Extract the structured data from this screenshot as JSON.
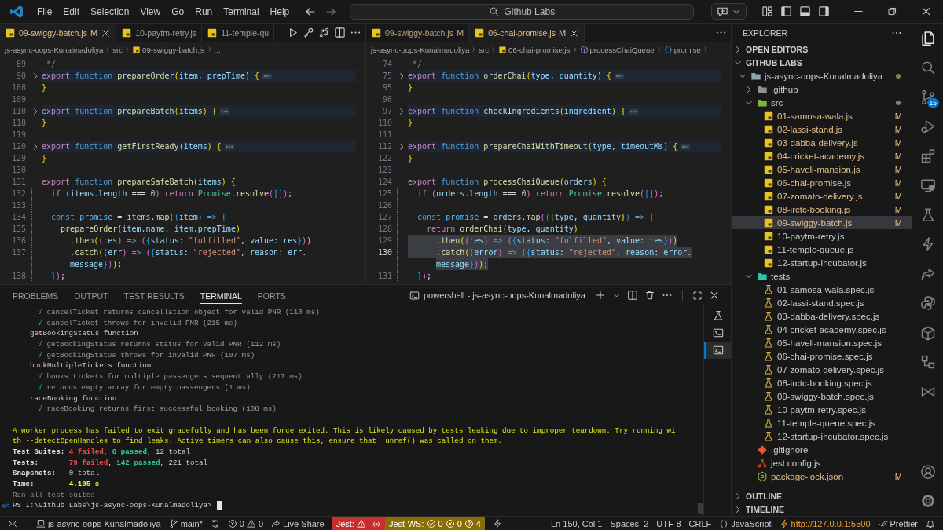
{
  "menu": [
    "File",
    "Edit",
    "Selection",
    "View",
    "Go",
    "Run",
    "Terminal",
    "Help"
  ],
  "title_bar": {
    "search": "Github Labs"
  },
  "editor_groups": [
    {
      "tabs": [
        {
          "label": "09-swiggy-batch.js",
          "badge": "M",
          "selected": true
        },
        {
          "label": "10-paytm-retry.js",
          "selected": false
        },
        {
          "label": "11-temple-qu",
          "selected": false
        }
      ],
      "actions": [
        {
          "kind": "run"
        },
        {
          "kind": "key"
        },
        {
          "kind": "compare"
        },
        {
          "kind": "split"
        },
        {
          "kind": "more"
        }
      ],
      "breadcrumbs": [
        {
          "text": "js-async-oops-Kunalmadoliya",
          "kind": "folder"
        },
        {
          "text": "src",
          "kind": "folder"
        },
        {
          "text": "09-swiggy-batch.js",
          "kind": "file"
        },
        {
          "text": "...",
          "kind": "folder"
        }
      ],
      "lines": [
        {
          "number": "89",
          "tokens": [
            {
              "kind": "comment",
              "text": " */"
            }
          ]
        },
        {
          "number": "90",
          "folded": true,
          "tokens": [
            {
              "kind": "keyword",
              "text": "export "
            },
            {
              "kind": "storage",
              "text": "function "
            },
            {
              "kind": "function",
              "text": "prepareOrder"
            },
            {
              "kind": "bracket1",
              "text": "("
            },
            {
              "kind": "variable",
              "text": "item"
            },
            {
              "kind": "plain",
              "text": ", "
            },
            {
              "kind": "variable",
              "text": "prepTime"
            },
            {
              "kind": "bracket1",
              "text": ") {"
            }
          ]
        },
        {
          "number": "108",
          "tokens": [
            {
              "kind": "bracket1",
              "text": "}"
            }
          ]
        },
        {
          "number": "109"
        },
        {
          "number": "110",
          "folded": true,
          "tokens": [
            {
              "kind": "keyword",
              "text": "export "
            },
            {
              "kind": "storage",
              "text": "function "
            },
            {
              "kind": "function",
              "text": "prepareBatch"
            },
            {
              "kind": "bracket1",
              "text": "("
            },
            {
              "kind": "variable",
              "text": "items"
            },
            {
              "kind": "bracket1",
              "text": ") {"
            }
          ]
        },
        {
          "number": "118",
          "tokens": [
            {
              "kind": "bracket1",
              "text": "}"
            }
          ]
        },
        {
          "number": "119"
        },
        {
          "number": "120",
          "folded": true,
          "tokens": [
            {
              "kind": "keyword",
              "text": "export "
            },
            {
              "kind": "storage",
              "text": "function "
            },
            {
              "kind": "function",
              "text": "getFirstReady"
            },
            {
              "kind": "bracket1",
              "text": "("
            },
            {
              "kind": "variable",
              "text": "items"
            },
            {
              "kind": "bracket1",
              "text": ") {"
            }
          ]
        },
        {
          "number": "129",
          "tokens": [
            {
              "kind": "bracket1",
              "text": "}"
            }
          ]
        },
        {
          "number": "130"
        },
        {
          "number": "131",
          "tokens": [
            {
              "kind": "keyword",
              "text": "export "
            },
            {
              "kind": "storage",
              "text": "function "
            },
            {
              "kind": "function",
              "text": "prepareSafeBatch"
            },
            {
              "kind": "bracket1",
              "text": "("
            },
            {
              "kind": "variable",
              "text": "items"
            },
            {
              "kind": "bracket1",
              "text": ") {"
            }
          ]
        },
        {
          "number": "132",
          "changed": true,
          "tokens": [
            {
              "kind": "keyword",
              "text": "  if "
            },
            {
              "kind": "bracket2",
              "text": "("
            },
            {
              "kind": "variable",
              "text": "items"
            },
            {
              "kind": "plain",
              "text": "."
            },
            {
              "kind": "variable",
              "text": "length"
            },
            {
              "kind": "plain",
              "text": " === "
            },
            {
              "kind": "number",
              "text": "0"
            },
            {
              "kind": "bracket2",
              "text": ") "
            },
            {
              "kind": "keyword",
              "text": "return "
            },
            {
              "kind": "class",
              "text": "Promise"
            },
            {
              "kind": "plain",
              "text": "."
            },
            {
              "kind": "function",
              "text": "resolve"
            },
            {
              "kind": "bracket2",
              "text": "("
            },
            {
              "kind": "bracket3",
              "text": "[]"
            },
            {
              "kind": "bracket2",
              "text": ")"
            },
            {
              "kind": "plain",
              "text": ";"
            }
          ]
        },
        {
          "number": "133",
          "changed": true
        },
        {
          "number": "134",
          "changed": true,
          "tokens": [
            {
              "kind": "storage",
              "text": "  const "
            },
            {
              "kind": "constant",
              "text": "promise"
            },
            {
              "kind": "plain",
              "text": " = "
            },
            {
              "kind": "variable",
              "text": "items"
            },
            {
              "kind": "plain",
              "text": "."
            },
            {
              "kind": "function",
              "text": "map"
            },
            {
              "kind": "bracket2",
              "text": "("
            },
            {
              "kind": "bracket3",
              "text": "("
            },
            {
              "kind": "variable",
              "text": "item"
            },
            {
              "kind": "bracket3",
              "text": ") "
            },
            {
              "kind": "storage",
              "text": "=> "
            },
            {
              "kind": "bracket3",
              "text": "{"
            }
          ]
        },
        {
          "number": "135",
          "changed": true,
          "tokens": [
            {
              "kind": "function",
              "text": "    prepareOrder"
            },
            {
              "kind": "bracket1",
              "text": "("
            },
            {
              "kind": "variable",
              "text": "item"
            },
            {
              "kind": "plain",
              "text": "."
            },
            {
              "kind": "variable",
              "text": "name"
            },
            {
              "kind": "plain",
              "text": ", "
            },
            {
              "kind": "variable",
              "text": "item"
            },
            {
              "kind": "plain",
              "text": "."
            },
            {
              "kind": "variable",
              "text": "prepTime"
            },
            {
              "kind": "bracket1",
              "text": ")"
            }
          ]
        },
        {
          "number": "136",
          "changed": true,
          "tokens": [
            {
              "kind": "plain",
              "text": "      ."
            },
            {
              "kind": "function",
              "text": "then"
            },
            {
              "kind": "bracket1",
              "text": "("
            },
            {
              "kind": "bracket2",
              "text": "("
            },
            {
              "kind": "variable",
              "text": "res"
            },
            {
              "kind": "bracket2",
              "text": ") "
            },
            {
              "kind": "storage",
              "text": "=> "
            },
            {
              "kind": "bracket2",
              "text": "("
            },
            {
              "kind": "bracket3",
              "text": "{"
            },
            {
              "kind": "variable",
              "text": "status"
            },
            {
              "kind": "plain",
              "text": ": "
            },
            {
              "kind": "string",
              "text": "\"fulfilled\""
            },
            {
              "kind": "plain",
              "text": ", "
            },
            {
              "kind": "variable",
              "text": "value"
            },
            {
              "kind": "plain",
              "text": ": "
            },
            {
              "kind": "variable",
              "text": "res"
            },
            {
              "kind": "bracket3",
              "text": "}"
            },
            {
              "kind": "bracket2",
              "text": ")"
            },
            {
              "kind": "bracket1",
              "text": ")"
            }
          ]
        },
        {
          "number": "137",
          "changed": true,
          "tokens": [
            {
              "kind": "plain",
              "text": "      ."
            },
            {
              "kind": "function",
              "text": "catch"
            },
            {
              "kind": "bracket1",
              "text": "("
            },
            {
              "kind": "bracket2",
              "text": "("
            },
            {
              "kind": "variable",
              "text": "err"
            },
            {
              "kind": "bracket2",
              "text": ") "
            },
            {
              "kind": "storage",
              "text": "=> "
            },
            {
              "kind": "bracket2",
              "text": "("
            },
            {
              "kind": "bracket3",
              "text": "{"
            },
            {
              "kind": "variable",
              "text": "status"
            },
            {
              "kind": "plain",
              "text": ": "
            },
            {
              "kind": "string",
              "text": "\"rejected\""
            },
            {
              "kind": "plain",
              "text": ", "
            },
            {
              "kind": "variable",
              "text": "reason"
            },
            {
              "kind": "plain",
              "text": ": "
            },
            {
              "kind": "variable",
              "text": "err"
            },
            {
              "kind": "plain",
              "text": "."
            }
          ],
          "wrap_tokens": [
            {
              "kind": "variable",
              "text": "message"
            },
            {
              "kind": "bracket3",
              "text": "}"
            },
            {
              "kind": "bracket2",
              "text": ")"
            },
            {
              "kind": "bracket1",
              "text": ")"
            },
            {
              "kind": "plain",
              "text": ";"
            }
          ]
        },
        {
          "number": "138",
          "changed": true,
          "tokens": [
            {
              "kind": "bracket3",
              "text": "  }"
            },
            {
              "kind": "bracket2",
              "text": ")"
            },
            {
              "kind": "plain",
              "text": ";"
            }
          ]
        }
      ]
    },
    {
      "tabs": [
        {
          "label": "09-swiggy-batch.js",
          "badge": "M",
          "selected": false
        },
        {
          "label": "06-chai-promise.js",
          "badge": "M",
          "selected": true
        }
      ],
      "actions": [
        {
          "kind": "more"
        }
      ],
      "breadcrumbs": [
        {
          "text": "js-async-oops-Kunalmadoliya",
          "kind": "folder"
        },
        {
          "text": "src",
          "kind": "folder"
        },
        {
          "text": "06-chai-promise.js",
          "kind": "file"
        },
        {
          "text": "processChaiQueue",
          "kind": "function"
        },
        {
          "text": "promise",
          "kind": "variable"
        }
      ],
      "breadcrumb_trailing_separator": true,
      "lines": [
        {
          "number": "74",
          "tokens": [
            {
              "kind": "comment",
              "text": " */"
            }
          ]
        },
        {
          "number": "75",
          "folded": true,
          "tokens": [
            {
              "kind": "keyword",
              "text": "export "
            },
            {
              "kind": "storage",
              "text": "function "
            },
            {
              "kind": "function",
              "text": "orderChai"
            },
            {
              "kind": "bracket1",
              "text": "("
            },
            {
              "kind": "variable",
              "text": "type"
            },
            {
              "kind": "plain",
              "text": ", "
            },
            {
              "kind": "variable",
              "text": "quantity"
            },
            {
              "kind": "bracket1",
              "text": ") {"
            }
          ]
        },
        {
          "number": "95",
          "tokens": [
            {
              "kind": "bracket1",
              "text": "}"
            }
          ]
        },
        {
          "number": "96"
        },
        {
          "number": "97",
          "folded": true,
          "tokens": [
            {
              "kind": "keyword",
              "text": "export "
            },
            {
              "kind": "storage",
              "text": "function "
            },
            {
              "kind": "function",
              "text": "checkIngredients"
            },
            {
              "kind": "bracket1",
              "text": "("
            },
            {
              "kind": "variable",
              "text": "ingredient"
            },
            {
              "kind": "bracket1",
              "text": ") {"
            }
          ]
        },
        {
          "number": "110",
          "tokens": [
            {
              "kind": "bracket1",
              "text": "}"
            }
          ]
        },
        {
          "number": "111"
        },
        {
          "number": "112",
          "folded": true,
          "tokens": [
            {
              "kind": "keyword",
              "text": "export "
            },
            {
              "kind": "storage",
              "text": "function "
            },
            {
              "kind": "function",
              "text": "prepareChaiWithTimeout"
            },
            {
              "kind": "bracket1",
              "text": "("
            },
            {
              "kind": "variable",
              "text": "type"
            },
            {
              "kind": "plain",
              "text": ", "
            },
            {
              "kind": "variable",
              "text": "timeoutMs"
            },
            {
              "kind": "bracket1",
              "text": ") {"
            }
          ]
        },
        {
          "number": "122",
          "tokens": [
            {
              "kind": "bracket1",
              "text": "}"
            }
          ]
        },
        {
          "number": "123"
        },
        {
          "number": "124",
          "tokens": [
            {
              "kind": "keyword",
              "text": "export "
            },
            {
              "kind": "storage",
              "text": "function "
            },
            {
              "kind": "function",
              "text": "processChaiQueue"
            },
            {
              "kind": "bracket1",
              "text": "("
            },
            {
              "kind": "variable",
              "text": "orders"
            },
            {
              "kind": "bracket1",
              "text": ") {"
            }
          ]
        },
        {
          "number": "125",
          "changed": true,
          "tokens": [
            {
              "kind": "keyword",
              "text": "  if "
            },
            {
              "kind": "bracket2",
              "text": "("
            },
            {
              "kind": "variable",
              "text": "orders"
            },
            {
              "kind": "plain",
              "text": "."
            },
            {
              "kind": "variable",
              "text": "length"
            },
            {
              "kind": "plain",
              "text": " === "
            },
            {
              "kind": "number",
              "text": "0"
            },
            {
              "kind": "bracket2",
              "text": ") "
            },
            {
              "kind": "keyword",
              "text": "return "
            },
            {
              "kind": "class",
              "text": "Promise"
            },
            {
              "kind": "plain",
              "text": "."
            },
            {
              "kind": "function",
              "text": "resolve"
            },
            {
              "kind": "bracket2",
              "text": "("
            },
            {
              "kind": "bracket3",
              "text": "[]"
            },
            {
              "kind": "bracket2",
              "text": ")"
            },
            {
              "kind": "plain",
              "text": ";"
            }
          ]
        },
        {
          "number": "126",
          "changed": true
        },
        {
          "number": "127",
          "changed": true,
          "tokens": [
            {
              "kind": "storage",
              "text": "  const "
            },
            {
              "kind": "constant",
              "text": "promise"
            },
            {
              "kind": "plain",
              "text": " = "
            },
            {
              "kind": "variable",
              "text": "orders"
            },
            {
              "kind": "plain",
              "text": "."
            },
            {
              "kind": "function",
              "text": "map"
            },
            {
              "kind": "bracket2",
              "text": "("
            },
            {
              "kind": "bracket3",
              "text": "("
            },
            {
              "kind": "bracket1",
              "text": "{"
            },
            {
              "kind": "variable",
              "text": "type"
            },
            {
              "kind": "plain",
              "text": ", "
            },
            {
              "kind": "variable",
              "text": "quantity"
            },
            {
              "kind": "bracket1",
              "text": "}"
            },
            {
              "kind": "bracket3",
              "text": ") "
            },
            {
              "kind": "storage",
              "text": "=> "
            },
            {
              "kind": "bracket3",
              "text": "{"
            }
          ]
        },
        {
          "number": "128",
          "changed": true,
          "tokens": [
            {
              "kind": "keyword",
              "text": "    return "
            },
            {
              "kind": "function",
              "text": "orderChai"
            },
            {
              "kind": "bracket1",
              "text": "("
            },
            {
              "kind": "variable",
              "text": "type"
            },
            {
              "kind": "plain",
              "text": ", "
            },
            {
              "kind": "variable",
              "text": "quantity"
            },
            {
              "kind": "bracket1",
              "text": ")"
            }
          ]
        },
        {
          "number": "129",
          "changed": true,
          "selected": true,
          "tokens": [
            {
              "kind": "plain",
              "text": "      ."
            },
            {
              "kind": "function",
              "text": "then"
            },
            {
              "kind": "bracket1",
              "text": "("
            },
            {
              "kind": "bracket2",
              "text": "("
            },
            {
              "kind": "variable",
              "text": "res"
            },
            {
              "kind": "bracket2",
              "text": ") "
            },
            {
              "kind": "storage",
              "text": "=> "
            },
            {
              "kind": "bracket2",
              "text": "("
            },
            {
              "kind": "bracket3",
              "text": "{"
            },
            {
              "kind": "variable",
              "text": "status"
            },
            {
              "kind": "plain",
              "text": ": "
            },
            {
              "kind": "string",
              "text": "\"fulfilled\""
            },
            {
              "kind": "plain",
              "text": ", "
            },
            {
              "kind": "variable",
              "text": "value"
            },
            {
              "kind": "plain",
              "text": ": "
            },
            {
              "kind": "variable",
              "text": "res"
            },
            {
              "kind": "bracket3",
              "text": "}"
            },
            {
              "kind": "bracket2",
              "text": ")"
            },
            {
              "kind": "bracket1",
              "text": ")"
            }
          ]
        },
        {
          "number": "130",
          "changed": true,
          "selected": true,
          "current": true,
          "tokens": [
            {
              "kind": "plain",
              "text": "      ."
            },
            {
              "kind": "function",
              "text": "catch"
            },
            {
              "kind": "bracket1",
              "text": "("
            },
            {
              "kind": "bracket2",
              "text": "("
            },
            {
              "kind": "variable",
              "text": "error"
            },
            {
              "kind": "bracket2",
              "text": ") "
            },
            {
              "kind": "storage",
              "text": "=> "
            },
            {
              "kind": "bracket2",
              "text": "("
            },
            {
              "kind": "bracket3",
              "text": "{"
            },
            {
              "kind": "variable",
              "text": "status"
            },
            {
              "kind": "plain",
              "text": ": "
            },
            {
              "kind": "string",
              "text": "\"rejected\""
            },
            {
              "kind": "plain",
              "text": ", "
            },
            {
              "kind": "variable",
              "text": "reason"
            },
            {
              "kind": "plain",
              "text": ": "
            },
            {
              "kind": "variable",
              "text": "error"
            },
            {
              "kind": "plain",
              "text": "."
            }
          ],
          "wrap_tokens": [
            {
              "kind": "variable",
              "text": "message"
            },
            {
              "kind": "bracket3",
              "text": "}"
            },
            {
              "kind": "bracket2",
              "text": ")"
            },
            {
              "kind": "bracket1",
              "text": ")"
            },
            {
              "kind": "plain",
              "text": ";"
            }
          ]
        },
        {
          "number": "131",
          "changed": true,
          "tokens": [
            {
              "kind": "bracket3",
              "text": "  }"
            },
            {
              "kind": "bracket2",
              "text": ")"
            },
            {
              "kind": "plain",
              "text": ";"
            }
          ]
        }
      ]
    }
  ],
  "panel": {
    "tabs": [
      {
        "label": "PROBLEMS",
        "selected": false
      },
      {
        "label": "OUTPUT",
        "selected": false
      },
      {
        "label": "TEST RESULTS",
        "selected": false
      },
      {
        "label": "TERMINAL",
        "selected": true
      },
      {
        "label": "PORTS",
        "selected": false
      }
    ],
    "terminal_title": "powershell - js-async-oops-Kunalmadoliya",
    "terminal_list": [
      {
        "kind": "test",
        "selected": false
      },
      {
        "kind": "shell",
        "selected": false
      },
      {
        "kind": "shell",
        "selected": true
      }
    ],
    "lines": [
      {
        "kind": "pass",
        "mark": "√",
        "text": "cancelTicket returns cancellation object for valid PNR (110 ms)"
      },
      {
        "kind": "pass",
        "mark": "√",
        "text": "cancelTicket throws for invalid PNR (215 ms)"
      },
      {
        "kind": "group",
        "text": "getBookingStatus function"
      },
      {
        "kind": "pass",
        "mark": "√",
        "text": "getBookingStatus returns status for valid PNR (112 ms)"
      },
      {
        "kind": "pass",
        "mark": "√",
        "text": "getBookingStatus throws for invalid PNR (107 ms)"
      },
      {
        "kind": "group",
        "text": "bookMultipleTickets function"
      },
      {
        "kind": "pass",
        "mark": "√",
        "text": "books tickets for multiple passengers sequentially (217 ms)"
      },
      {
        "kind": "pass",
        "mark": "√",
        "text": "returns empty array for empty passengers (1 ms)"
      },
      {
        "kind": "group",
        "text": "raceBooking function"
      },
      {
        "kind": "pass",
        "mark": "√",
        "text": "raceBooking returns first successful booking (108 ms)"
      },
      {
        "kind": "blank"
      },
      {
        "kind": "warning",
        "text": "A worker process has failed to exit gracefully and has been force exited. This is likely caused by tests leaking due to improper teardown. Try running wi"
      },
      {
        "kind": "warning",
        "text": "th --detectOpenHandles to find leaks. Active timers can also cause this, ensure that .unref() was called on them."
      },
      {
        "kind": "summary",
        "label": "Test Suites:",
        "parts": [
          {
            "kind": "fail",
            "text": "4 failed"
          },
          {
            "kind": "plain",
            "text": ", "
          },
          {
            "kind": "pass",
            "text": "8 passed"
          },
          {
            "kind": "plain",
            "text": ", 12 total"
          }
        ]
      },
      {
        "kind": "summary",
        "label": "Tests:",
        "parts": [
          {
            "kind": "fail",
            "text": "79 failed"
          },
          {
            "kind": "plain",
            "text": ", "
          },
          {
            "kind": "pass",
            "text": "142 passed"
          },
          {
            "kind": "plain",
            "text": ", 221 total"
          }
        ]
      },
      {
        "kind": "summary",
        "label": "Snapshots:",
        "parts": [
          {
            "kind": "plain",
            "text": "0 total"
          }
        ]
      },
      {
        "kind": "summary",
        "label": "Time:",
        "parts": [
          {
            "kind": "time",
            "text": "4.105 s"
          }
        ]
      },
      {
        "kind": "note",
        "text": "Ran all test suites."
      },
      {
        "kind": "prompt",
        "text": "PS I:\\Github Labs\\js-async-oops-Kunalmadoliya>"
      }
    ]
  },
  "explorer": {
    "title": "EXPLORER",
    "sections": [
      {
        "label": "OPEN EDITORS",
        "expanded": false
      },
      {
        "label": "GITHUB LABS",
        "expanded": true,
        "tree": [
          {
            "name": "js-async-oops-Kunalmadoliya",
            "kind": "folder",
            "expanded": true,
            "dirty": true,
            "selected": false,
            "children": [
              {
                "name": ".github",
                "kind": "folder-github",
                "expanded": false,
                "selected": false
              },
              {
                "name": "src",
                "kind": "folder-src",
                "expanded": true,
                "dirty": true,
                "selected": false,
                "children": [
                  {
                    "name": "01-samosa-wala.js",
                    "kind": "js",
                    "badge": "M",
                    "selected": false
                  },
                  {
                    "name": "02-lassi-stand.js",
                    "kind": "js",
                    "badge": "M",
                    "selected": false
                  },
                  {
                    "name": "03-dabba-delivery.js",
                    "kind": "js",
                    "badge": "M",
                    "selected": false
                  },
                  {
                    "name": "04-cricket-academy.js",
                    "kind": "js",
                    "badge": "M",
                    "selected": false
                  },
                  {
                    "name": "05-haveli-mansion.js",
                    "kind": "js",
                    "badge": "M",
                    "selected": false
                  },
                  {
                    "name": "06-chai-promise.js",
                    "kind": "js",
                    "badge": "M",
                    "selected": false
                  },
                  {
                    "name": "07-zomato-delivery.js",
                    "kind": "js",
                    "badge": "M",
                    "selected": false
                  },
                  {
                    "name": "08-irctc-booking.js",
                    "kind": "js",
                    "badge": "M",
                    "selected": false
                  },
                  {
                    "name": "09-swiggy-batch.js",
                    "kind": "js",
                    "badge": "M",
                    "selected": true
                  },
                  {
                    "name": "10-paytm-retry.js",
                    "kind": "js",
                    "selected": false
                  },
                  {
                    "name": "11-temple-queue.js",
                    "kind": "js",
                    "selected": false
                  },
                  {
                    "name": "12-startup-incubator.js",
                    "kind": "js",
                    "selected": false
                  }
                ]
              },
              {
                "name": "tests",
                "kind": "folder-tests",
                "expanded": true,
                "selected": false,
                "children": [
                  {
                    "name": "01-samosa-wala.spec.js",
                    "kind": "spec",
                    "selected": false
                  },
                  {
                    "name": "02-lassi-stand.spec.js",
                    "kind": "spec",
                    "selected": false
                  },
                  {
                    "name": "03-dabba-delivery.spec.js",
                    "kind": "spec",
                    "selected": false
                  },
                  {
                    "name": "04-cricket-academy.spec.js",
                    "kind": "spec",
                    "selected": false
                  },
                  {
                    "name": "05-haveli-mansion.spec.js",
                    "kind": "spec",
                    "selected": false
                  },
                  {
                    "name": "06-chai-promise.spec.js",
                    "kind": "spec",
                    "selected": false
                  },
                  {
                    "name": "07-zomato-delivery.spec.js",
                    "kind": "spec",
                    "selected": false
                  },
                  {
                    "name": "08-irctc-booking.spec.js",
                    "kind": "spec",
                    "selected": false
                  },
                  {
                    "name": "09-swiggy-batch.spec.js",
                    "kind": "spec",
                    "selected": false
                  },
                  {
                    "name": "10-paytm-retry.spec.js",
                    "kind": "spec",
                    "selected": false
                  },
                  {
                    "name": "11-temple-queue.spec.js",
                    "kind": "spec",
                    "selected": false
                  },
                  {
                    "name": "12-startup-incubator.spec.js",
                    "kind": "spec",
                    "selected": false
                  }
                ]
              },
              {
                "name": ".gitignore",
                "kind": "git",
                "selected": false
              },
              {
                "name": "jest.config.js",
                "kind": "jest",
                "selected": false
              },
              {
                "name": "package-lock.json",
                "kind": "json",
                "badge": "M",
                "selected": false
              }
            ]
          }
        ]
      },
      {
        "label": "OUTLINE",
        "expanded": false
      },
      {
        "label": "TIMELINE",
        "expanded": false
      }
    ]
  },
  "activity_bar": [
    {
      "kind": "files",
      "selected": true
    },
    {
      "kind": "search",
      "selected": false
    },
    {
      "kind": "source-control",
      "badge": "15",
      "selected": false
    },
    {
      "kind": "run-debug",
      "selected": false
    },
    {
      "kind": "extensions",
      "selected": false
    },
    {
      "kind": "remote",
      "selected": false
    },
    {
      "kind": "testing",
      "selected": false
    },
    {
      "kind": "lightning",
      "selected": false
    },
    {
      "kind": "share",
      "selected": false
    },
    {
      "kind": "python",
      "selected": false
    },
    {
      "kind": "box",
      "selected": false
    },
    {
      "kind": "diagram",
      "selected": false
    },
    {
      "kind": "bowtie",
      "selected": false
    },
    {
      "kind": "account",
      "selected": false,
      "bottom": true
    },
    {
      "kind": "gear",
      "selected": false
    }
  ],
  "status_bar": {
    "left": [
      {
        "kind": "remote"
      },
      {
        "kind": "workspace",
        "text": "js-async-oops-Kunalmadoliya"
      },
      {
        "kind": "branch",
        "text": "main*"
      },
      {
        "kind": "sync"
      },
      {
        "kind": "problems",
        "errors": "0",
        "warnings": "0"
      },
      {
        "kind": "liveshare",
        "text": "Live Share"
      },
      {
        "kind": "jest",
        "text": "Jest:"
      },
      {
        "kind": "jest-ws",
        "text": "Jest-WS:",
        "passed": "0",
        "failed": "0",
        "unknown": "4"
      },
      {
        "kind": "lightning"
      }
    ],
    "right": [
      {
        "kind": "text",
        "text": "Ln 150, Col 1"
      },
      {
        "kind": "text",
        "text": "Spaces: 2"
      },
      {
        "kind": "text",
        "text": "UTF-8"
      },
      {
        "kind": "text",
        "text": "CRLF"
      },
      {
        "kind": "language",
        "text": "JavaScript"
      },
      {
        "kind": "golive",
        "text": "http://127.0.0.1:5500"
      },
      {
        "kind": "prettier",
        "text": "Prettier"
      },
      {
        "kind": "bell"
      }
    ]
  }
}
